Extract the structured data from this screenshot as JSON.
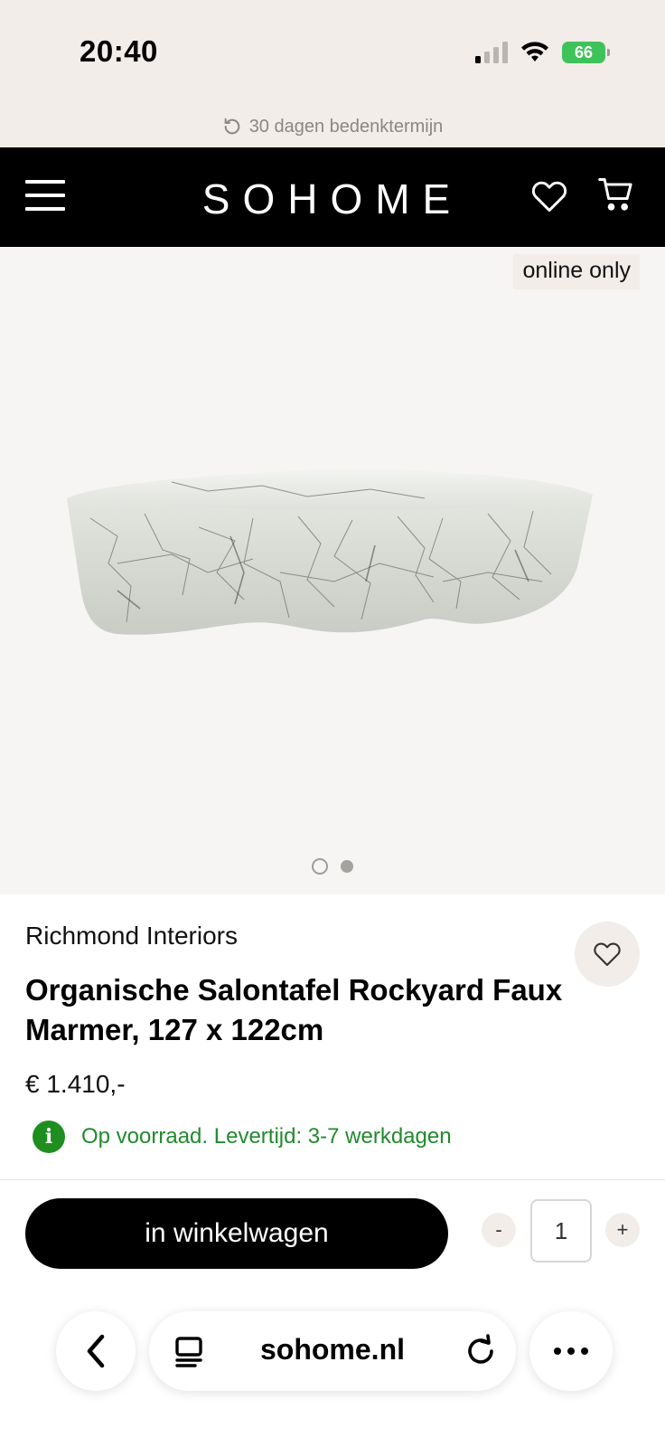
{
  "status_bar": {
    "time": "20:40",
    "battery_level": "66",
    "signal_bars_active": 1,
    "signal_bars_total": 4
  },
  "promo": {
    "text": "30 dagen bedenktermijn",
    "icon": "return-arrow-icon"
  },
  "header": {
    "logo": "SOHOME",
    "menu_icon": "hamburger-menu-icon",
    "wishlist_icon": "heart-icon",
    "cart_icon": "cart-icon",
    "background": "#000000"
  },
  "product": {
    "badge": "online only",
    "image_alt": "marble coffee table",
    "image_count": 2,
    "active_image": 1,
    "brand": "Richmond Interiors",
    "title": "Organische Salontafel Rockyard Faux Marmer, 127 x 122cm",
    "price": "€ 1.410,-",
    "stock_text": "Op voorraad. Levertijd: 3-7 werkdagen",
    "stock_color": "#218a2d"
  },
  "buy_bar": {
    "add_to_cart_label": "in winkelwagen",
    "qty_minus": "-",
    "qty_plus": "+",
    "quantity": "1"
  },
  "browser": {
    "url": "sohome.nl",
    "back_icon": "chevron-left-icon",
    "tabs_icon": "tabs-icon",
    "reload_icon": "reload-icon",
    "more_icon": "more-dots-icon"
  },
  "colors": {
    "page_bg": "#f2ede8",
    "accent_black": "#000000",
    "success_green": "#1e8f1e"
  }
}
